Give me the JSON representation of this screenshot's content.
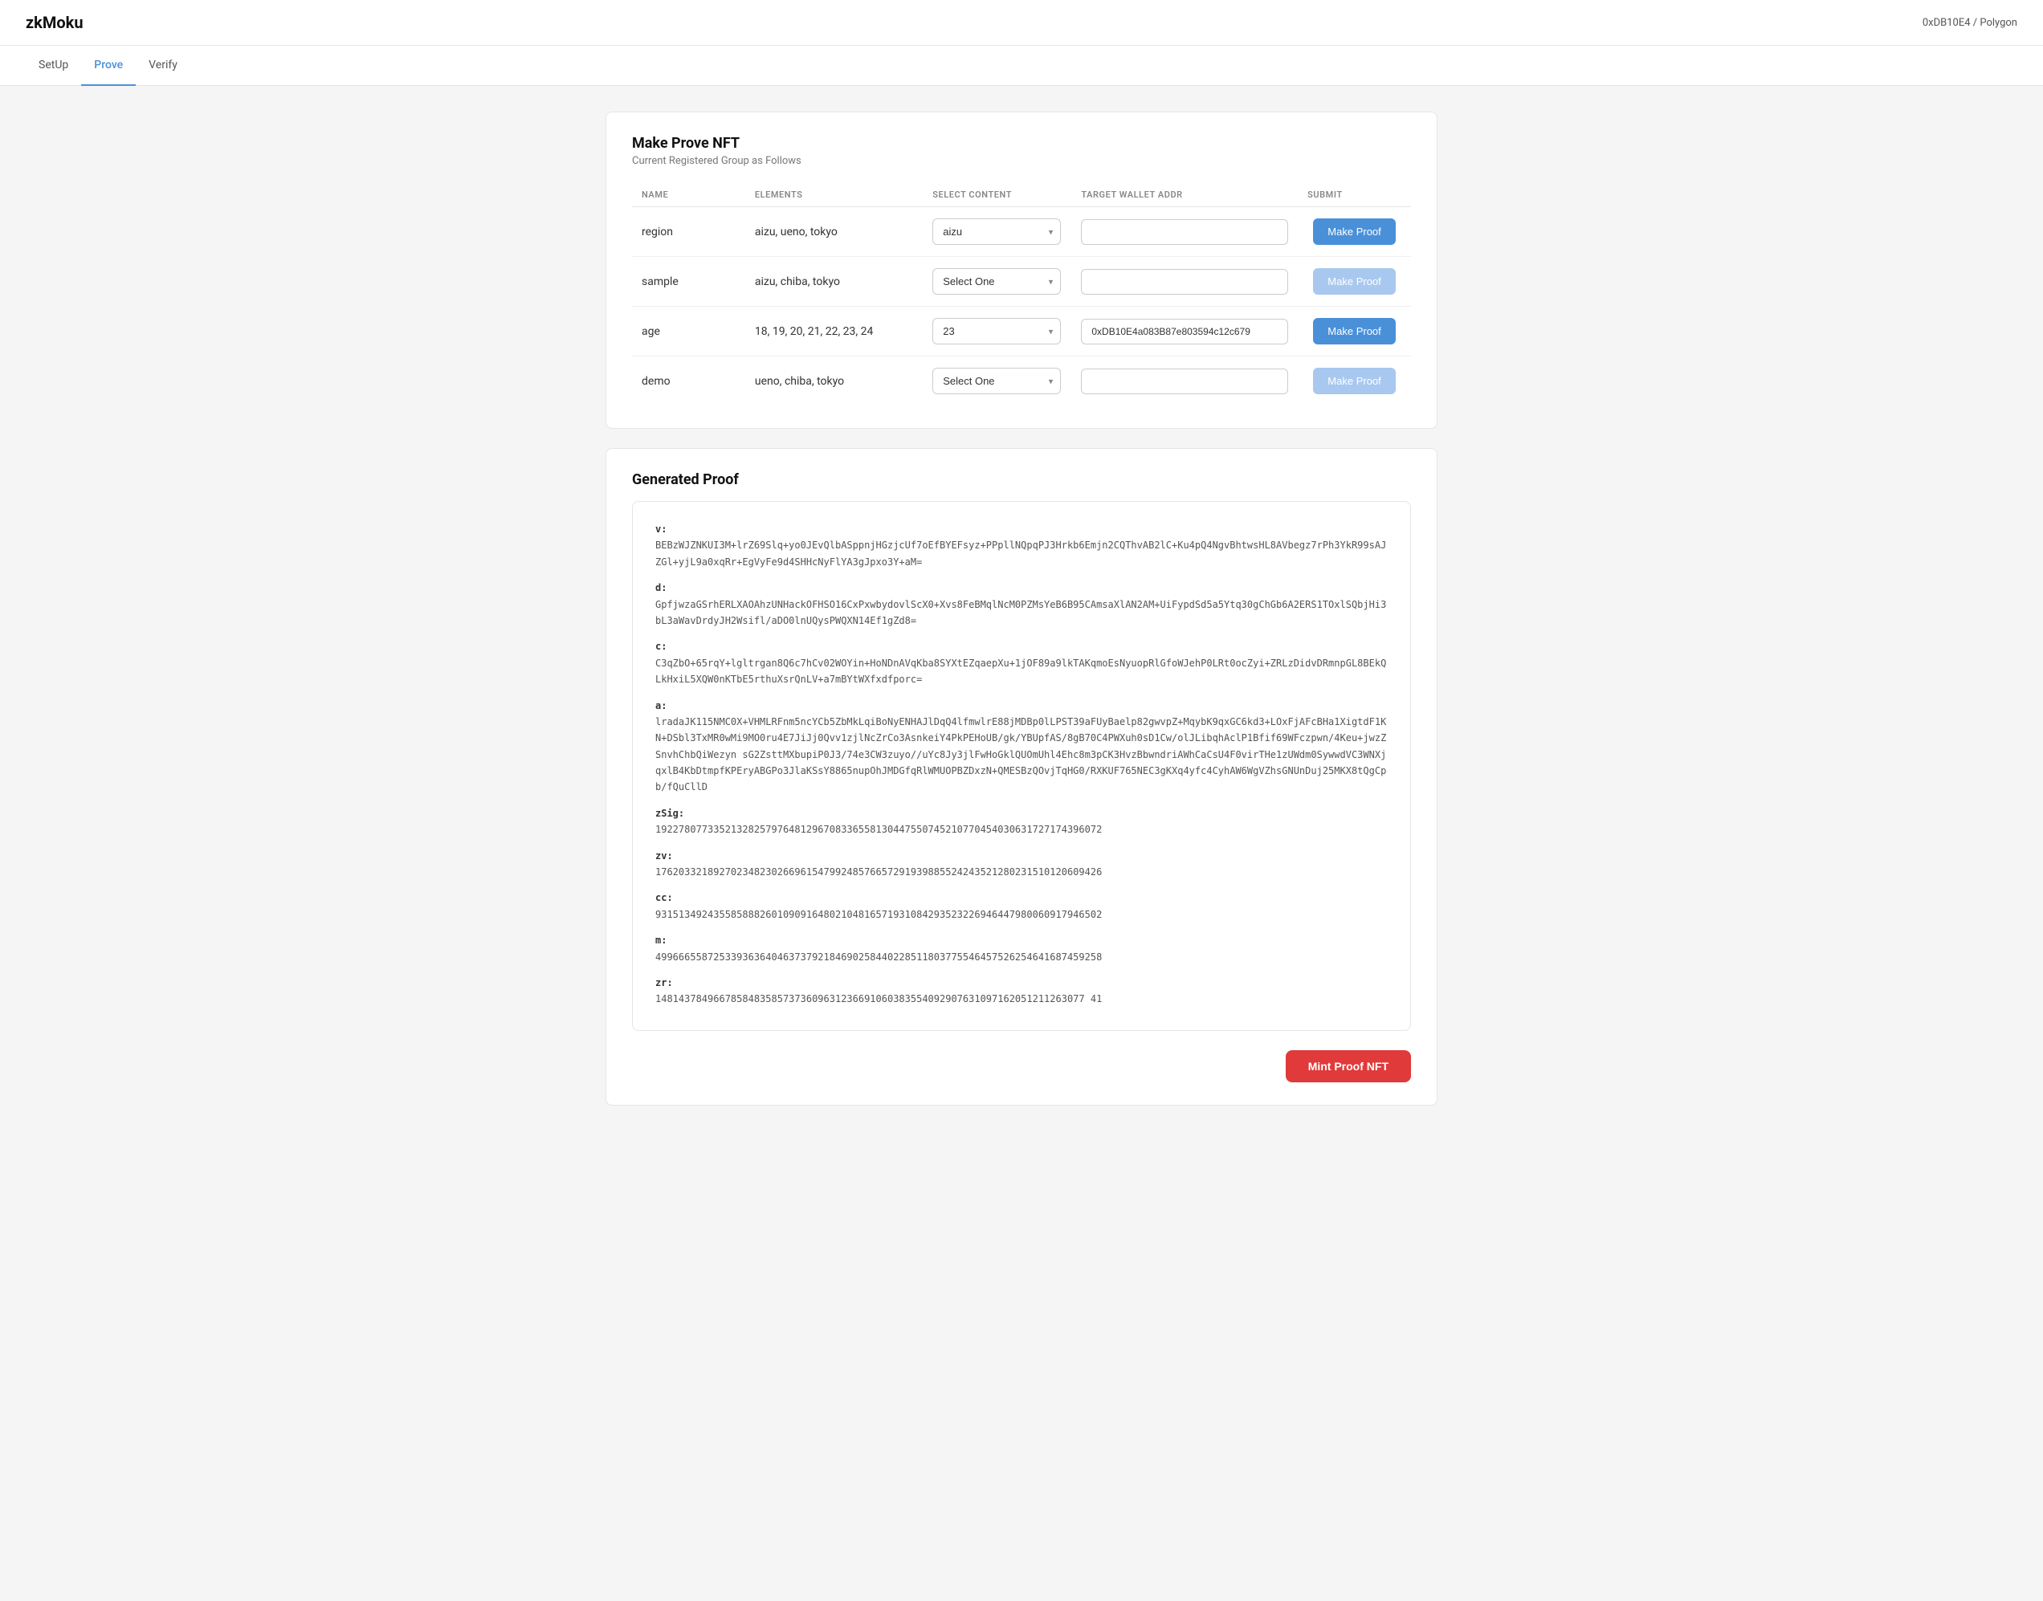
{
  "header": {
    "logo": "zkMoku",
    "wallet": "0xDB10E4 / Polygon"
  },
  "nav": {
    "items": [
      {
        "label": "SetUp",
        "active": false
      },
      {
        "label": "Prove",
        "active": true
      },
      {
        "label": "Verify",
        "active": false
      }
    ]
  },
  "makeProveNFT": {
    "title": "Make Prove NFT",
    "subtitle": "Current Registered Group as Follows",
    "table": {
      "columns": [
        "NAME",
        "ELEMENTS",
        "SELECT CONTENT",
        "TARGET WALLET ADDR",
        "SUBMIT"
      ],
      "rows": [
        {
          "name": "region",
          "elements": "aizu, ueno, tokyo",
          "selectValue": "aizu",
          "selectOptions": [
            "aizu",
            "ueno",
            "tokyo"
          ],
          "walletValue": "",
          "walletPlaceholder": "",
          "buttonLabel": "Make Proof",
          "buttonDisabled": false
        },
        {
          "name": "sample",
          "elements": "aizu, chiba, tokyo",
          "selectValue": "Select One",
          "selectOptions": [
            "Select One",
            "aizu",
            "chiba",
            "tokyo"
          ],
          "walletValue": "",
          "walletPlaceholder": "",
          "buttonLabel": "Make Proof",
          "buttonDisabled": true
        },
        {
          "name": "age",
          "elements": "18, 19, 20, 21, 22, 23, 24",
          "selectValue": "23",
          "selectOptions": [
            "18",
            "19",
            "20",
            "21",
            "22",
            "23",
            "24"
          ],
          "walletValue": "0xDB10E4a083B87e803594c12c679",
          "walletPlaceholder": "",
          "buttonLabel": "Make Proof",
          "buttonDisabled": false
        },
        {
          "name": "demo",
          "elements": "ueno, chiba, tokyo",
          "selectValue": "Select One",
          "selectOptions": [
            "Select One",
            "ueno",
            "chiba",
            "tokyo"
          ],
          "walletValue": "",
          "walletPlaceholder": "",
          "buttonLabel": "Make Proof",
          "buttonDisabled": true
        }
      ]
    }
  },
  "generatedProof": {
    "title": "Generated Proof",
    "sections": [
      {
        "label": "v:",
        "value": "BEBzWJZNKUI3M+lrZ69Slq+yo0JEvQlbASppnjHGzjcUf7oEfBYEFsyz+PPpllNQpqPJ3Hrkb6Emjn2CQThvAB2lC+Ku4pQ4NgvBhtwsHL8AVbegz7rPh3YkR99sAJZGl+yjL9a0xqRr+EgVyFe9d4SHHcNyFlYA3gJpxo3Y+aM="
      },
      {
        "label": "d:",
        "value": "GpfjwzaGSrhERLXAOAhzUNHackOFHSO16CxPxwbydovlScX0+Xvs8FeBMqlNcM0PZMsYeB6B95CAmsaXlAN2AM+UiFypdSd5a5Ytq30gChGb6A2ERS1TOxlSQbjHi3bL3aWavDrdyJH2Wsifl/aDO0lnUQysPWQXN14Ef1gZd8="
      },
      {
        "label": "c:",
        "value": "C3qZbO+65rqY+lgltrgan8Q6c7hCv02WOYin+HoNDnAVqKba8SYXtEZqaepXu+1jOF89a9lkTAKqmoEsNyuopRlGfoWJehP0LRt0ocZyi+ZRLzDidvDRmnpGL8BEkQLkHxiL5XQW0nKTbE5rthuXsrQnLV+a7mBYtWXfxdfporc="
      },
      {
        "label": "a:",
        "value": "lradaJK115NMC0X+VHMLRFnm5ncYCb5ZbMkLqiBoNyENHAJlDqQ4lfmwlrE88jMDBp0lLPST39aFUyBaelp82gwvpZ+MqybK9qxGC6kd3+LOxFjAFcBHa1XigtdF1KN+DSbl3TxMR0wMi9MO0ru4E7JiJj0Qvv1zjlNcZrCo3AsnkeiY4PkPEHoUB/gk/YBUpfAS/8gB70C4PWXuh0sD1Cw/olJLibqhAclP1Bfif69WFczpwn/4Keu+jwzZSnvhChbQiWezyn sG2ZsttMXbupiP0J3/74e3CW3zuyo//uYc8Jy3jlFwHoGklQUOmUhl4Ehc8m3pCK3HvzBbwndriAWhCaCsU4F0virTHe1zUWdm0SywwdVC3WNXjqxlB4KbDtmpfKPEryABGPo3JlaKSsY8865nupOhJMDGfqRlWMUOPBZDxzN+QMESBzQOvjTqHG0/RXKUF765NEC3gKXq4yfc4CyhAW6WgVZhsGNUnDuj25MKX8tQgCpb/fQuCllD"
      },
      {
        "label": "zSig:",
        "value": "19227807733521328257976481296708336558130447550745210770454030631727174396072"
      },
      {
        "label": "zv:",
        "value": "17620332189270234823026696154799248576657291939885524243521280231510120609426"
      },
      {
        "label": "cc:",
        "value": "93151349243558588826010909164802104816571931084293523226946447980060917946502"
      },
      {
        "label": "m:",
        "value": "49966655872533936364046373792184690258440228511803775546457526254641687459258"
      },
      {
        "label": "zr:",
        "value": "14814378496678584835857373609631236691060383554092907631097162051211263077 41"
      }
    ]
  },
  "actions": {
    "mintLabel": "Mint Proof NFT"
  },
  "colors": {
    "accent": "#4a90d9",
    "disabled": "#a8c8ef",
    "danger": "#e03a3a",
    "activeTab": "#4a90d9"
  }
}
